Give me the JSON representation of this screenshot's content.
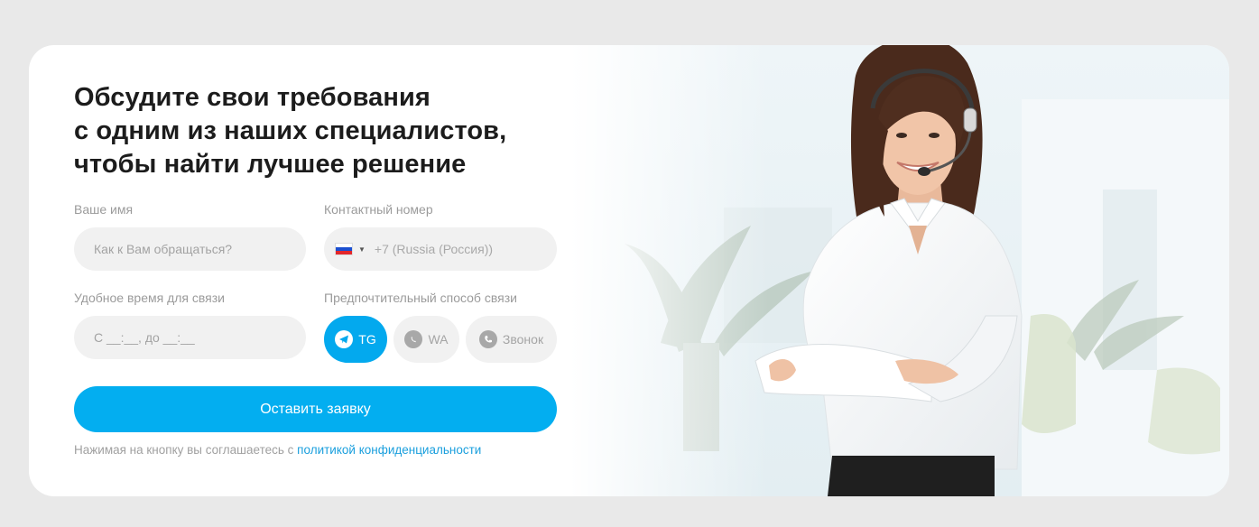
{
  "form": {
    "title_lines": [
      "Обсудите свои требования",
      "с одним из наших специалистов,",
      "чтобы найти лучшее решение"
    ],
    "name": {
      "label": "Ваше имя",
      "placeholder": "Как к Вам обращаться?",
      "value": ""
    },
    "phone": {
      "label": "Контактный номер",
      "country_code_text": "+7 (Russia (Россия))",
      "flag": "russia-flag-icon"
    },
    "time": {
      "label": "Удобное время для связи",
      "placeholder": "С __:__, до __:__",
      "value": ""
    },
    "contact_method": {
      "label": "Предпочтительный способ связи",
      "options": [
        {
          "label": "TG",
          "icon": "telegram-icon",
          "selected": true
        },
        {
          "label": "WA",
          "icon": "whatsapp-icon",
          "selected": false
        },
        {
          "label": "Звонок",
          "icon": "phone-icon",
          "selected": false
        }
      ]
    },
    "submit_label": "Оставить заявку",
    "consent_text": "Нажимая на кнопку вы соглашаетесь с",
    "consent_link": "политикой конфиденциальности"
  },
  "colors": {
    "accent": "#03aef0",
    "page_bg": "#e9e9e9",
    "card_bg": "#ffffff",
    "field_bg": "#f1f1f1",
    "link": "#1a9fdd"
  }
}
